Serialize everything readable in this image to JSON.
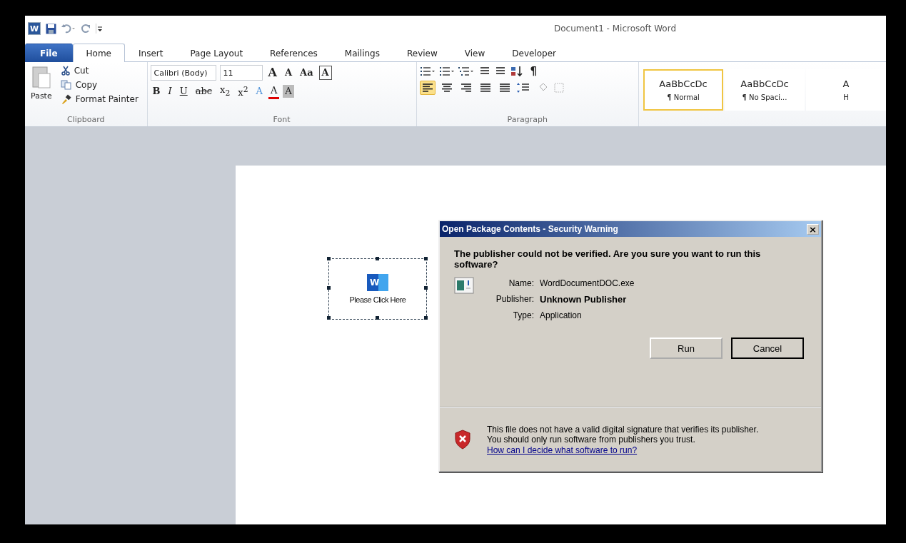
{
  "window": {
    "logo": "W",
    "title": "Document1 - Microsoft Word"
  },
  "tabs": [
    {
      "label": "File",
      "kind": "file",
      "selected": false
    },
    {
      "label": "Home",
      "kind": "tab",
      "selected": true
    },
    {
      "label": "Insert",
      "kind": "tab",
      "selected": false
    },
    {
      "label": "Page Layout",
      "kind": "tab",
      "selected": false
    },
    {
      "label": "References",
      "kind": "tab",
      "selected": false
    },
    {
      "label": "Mailings",
      "kind": "tab",
      "selected": false
    },
    {
      "label": "Review",
      "kind": "tab",
      "selected": false
    },
    {
      "label": "View",
      "kind": "tab",
      "selected": false
    },
    {
      "label": "Developer",
      "kind": "tab",
      "selected": false
    }
  ],
  "clipboard": {
    "paste": "Paste",
    "items": [
      {
        "label": "Cut",
        "kind": "cut"
      },
      {
        "label": "Copy",
        "kind": "copy"
      },
      {
        "label": "Format Painter",
        "kind": "painter"
      }
    ],
    "label": "Clipboard"
  },
  "font": {
    "name": "Calibri (Body)",
    "size": "11",
    "label": "Font",
    "row1": [
      {
        "label": "A",
        "kind": "grow"
      },
      {
        "label": "A",
        "kind": "shrink"
      },
      {
        "label": "Aa",
        "kind": "case"
      },
      {
        "label": "A",
        "kind": "boxed"
      }
    ],
    "row2": [
      {
        "label": "B",
        "kind": "bold"
      },
      {
        "label": "I",
        "kind": "italic"
      },
      {
        "label": "U",
        "kind": "underline"
      },
      {
        "label": "abc",
        "kind": "strike"
      },
      {
        "label": "x$_{2}$",
        "kind": "plain"
      },
      {
        "label": "x$^{2}$",
        "kind": "plain"
      },
      {
        "label": "A",
        "kind": "effects"
      },
      {
        "label": "A",
        "kind": "color"
      },
      {
        "label": "A",
        "kind": "shade"
      }
    ]
  },
  "paragraph": {
    "label": "Paragraph",
    "show_marks": "¶",
    "align": [
      {
        "kind": "left",
        "selected": true
      },
      {
        "kind": "center",
        "selected": false
      },
      {
        "kind": "right",
        "selected": false
      },
      {
        "kind": "justify",
        "selected": false
      },
      {
        "kind": "distribute",
        "selected": false
      }
    ]
  },
  "styles": [
    {
      "preview": "AaBbCcDc",
      "name": "¶ Normal",
      "selected": true
    },
    {
      "preview": "AaBbCcDc",
      "name": "¶ No Spaci...",
      "selected": false
    },
    {
      "preview": "A",
      "name": "H",
      "selected": false
    }
  ],
  "embedded_object": {
    "icon_letter": "W",
    "caption": "Please Click Here",
    "selected": true
  },
  "dialog": {
    "title": "Open Package Contents - Security Warning",
    "close": "×",
    "question": "The publisher could not be verified.  Are you sure you want to run this software?",
    "fields": [
      {
        "label": "Name:",
        "value": "WordDocumentDOC.exe",
        "bold": false
      },
      {
        "label": "Publisher:",
        "value": "Unknown Publisher",
        "bold": true
      },
      {
        "label": "Type:",
        "value": "Application",
        "bold": false
      }
    ],
    "buttons": [
      {
        "label": "Run",
        "default": false
      },
      {
        "label": "Cancel",
        "default": true
      }
    ],
    "warning": "This file does not have a valid digital signature that verifies its publisher.  You should only run software from publishers you trust.",
    "link": "How can I decide what software to run?"
  }
}
